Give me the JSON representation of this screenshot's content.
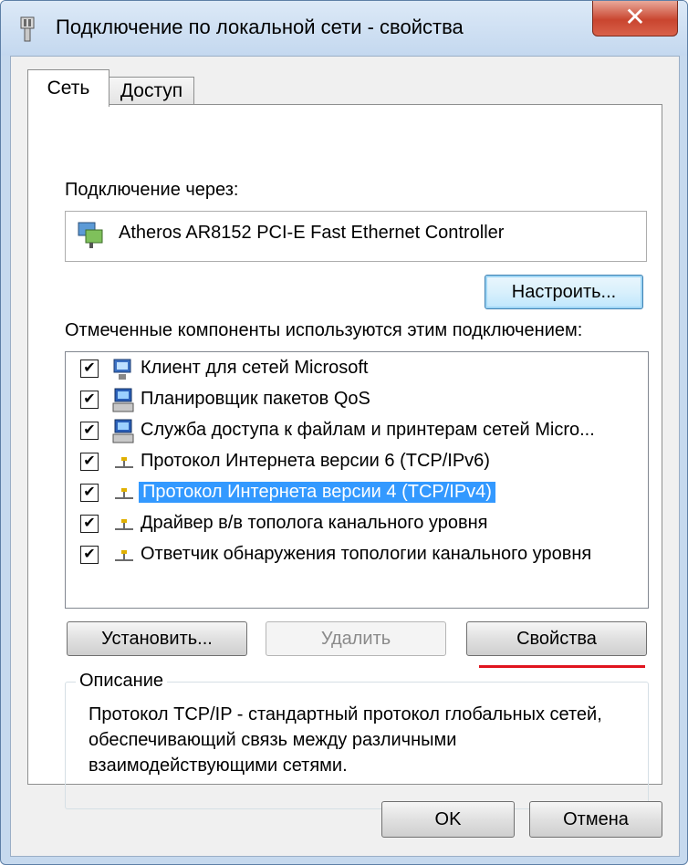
{
  "window": {
    "title": "Подключение по локальной сети - свойства",
    "close_glyph": "✕",
    "title_icon": "network-adapter-icon"
  },
  "tabs": [
    {
      "label": "Сеть",
      "active": true
    },
    {
      "label": "Доступ",
      "active": false
    }
  ],
  "connection": {
    "label": "Подключение через:",
    "adapter_name": "Atheros AR8152 PCI-E Fast Ethernet Controller",
    "configure_button": "Настроить..."
  },
  "components": {
    "label": "Отмеченные компоненты используются этим подключением:",
    "items": [
      {
        "label": "Клиент для сетей Microsoft",
        "checked": true,
        "icon": "network-client-icon"
      },
      {
        "label": "Планировщик пакетов QoS",
        "checked": true,
        "icon": "network-service-icon"
      },
      {
        "label": "Служба доступа к файлам и принтерам сетей Micro...",
        "checked": true,
        "icon": "network-service-icon"
      },
      {
        "label": "Протокол Интернета версии 6 (TCP/IPv6)",
        "checked": true,
        "icon": "network-protocol-icon"
      },
      {
        "label": "Протокол Интернета версии 4 (TCP/IPv4)",
        "checked": true,
        "icon": "network-protocol-icon",
        "selected": true
      },
      {
        "label": "Драйвер в/в тополога канального уровня",
        "checked": true,
        "icon": "network-protocol-icon"
      },
      {
        "label": "Ответчик обнаружения топологии канального уровня",
        "checked": true,
        "icon": "network-protocol-icon"
      }
    ],
    "check_glyph": "✔"
  },
  "actions": {
    "install": "Установить...",
    "remove": "Удалить",
    "properties": "Свойства"
  },
  "description": {
    "legend": "Описание",
    "text": "Протокол TCP/IP - стандартный протокол глобальных сетей, обеспечивающий связь между различными взаимодействующими сетями."
  },
  "footer": {
    "ok": "OK",
    "cancel": "Отмена"
  },
  "colors": {
    "selection": "#3399ff",
    "highlight_underline": "#e0141e",
    "close_button": "#c9452f"
  }
}
